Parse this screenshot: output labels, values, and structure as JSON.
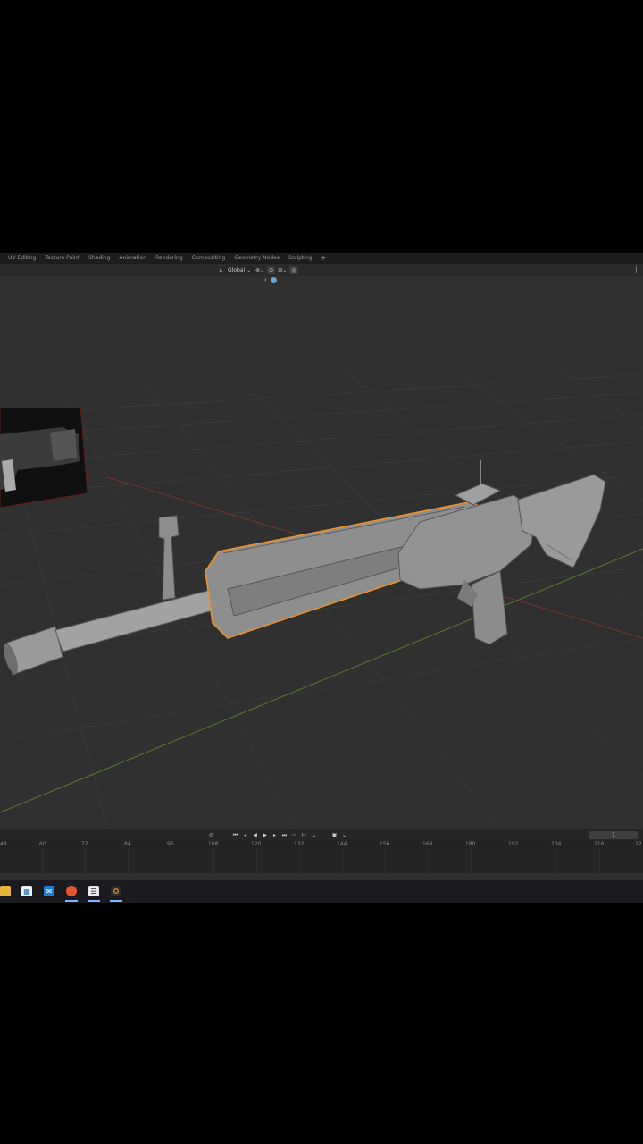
{
  "workspace_tabs": [
    "UV Editing",
    "Texture Paint",
    "Shading",
    "Animation",
    "Rendering",
    "Compositing",
    "Geometry Nodes",
    "Scripting"
  ],
  "add_tab_label": "+",
  "viewport_header": {
    "transform_orientation": "Global",
    "orientation_icon": "transform-axes-icon",
    "pivot_icon": "pivot-point-icon",
    "snap_icon": "snap-magnet-icon",
    "proportional_icon": "proportional-edit-icon",
    "overlay_toggle": "›"
  },
  "timeline": {
    "current_frame": "1",
    "ruler_ticks": [
      "48",
      "60",
      "72",
      "84",
      "96",
      "108",
      "120",
      "132",
      "144",
      "156",
      "168",
      "180",
      "192",
      "204",
      "216",
      "22"
    ]
  },
  "taskbar": {
    "icons": [
      "file-explorer-icon",
      "store-icon",
      "mail-icon",
      "firefox-icon",
      "terminal-icon",
      "blender-icon"
    ]
  },
  "colors": {
    "viewport_bg": "#303030",
    "selection_outline": "#e8922c",
    "x_axis": "#a33a3a",
    "y_axis": "#6f8f2a",
    "model_gray": "#8f8f8f"
  }
}
